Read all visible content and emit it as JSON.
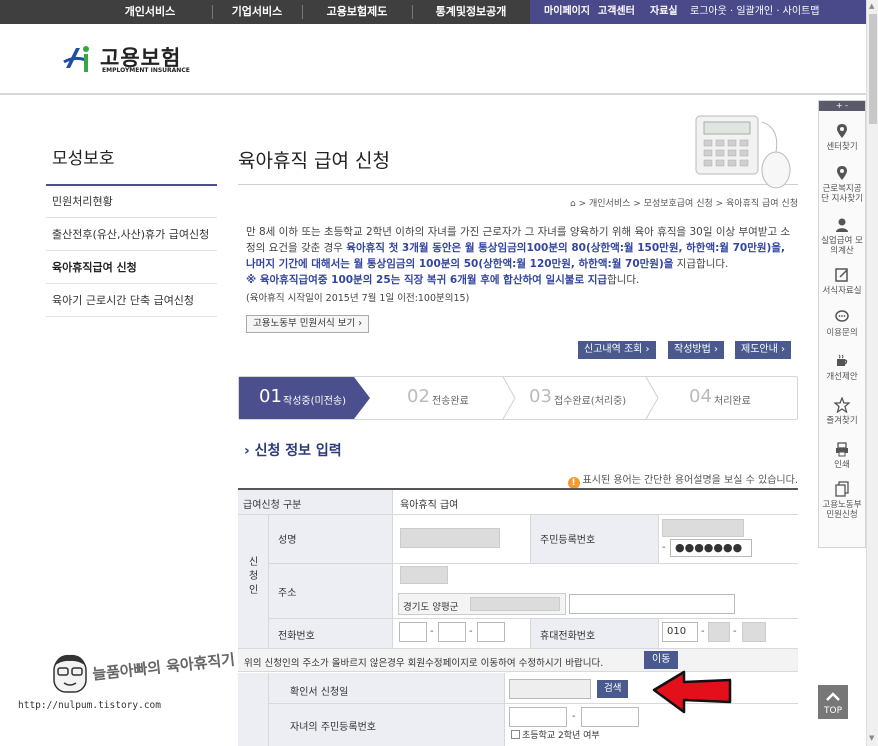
{
  "top_nav": {
    "items": [
      "개인서비스",
      "기업서비스",
      "고용보험제도",
      "통계및정보공개"
    ],
    "mypage": "마이페이지",
    "customer_center": "고객센터",
    "data_room": "자료실",
    "util": "로그아웃 · 일괄개인 · 사이트맵"
  },
  "logo": {
    "name": "고용보험",
    "sub": "EMPLOYMENT INSURANCE"
  },
  "left_menu": {
    "title": "모성보호",
    "items": [
      "민원처리현황",
      "출산전후(유산,사산)휴가 급여신청",
      "육아휴직급여 신청",
      "육아기 근로시간 단축 급여신청"
    ]
  },
  "page": {
    "title": "육아휴직 급여 신청",
    "breadcrumb": "> 개인서비스 > 모성보호급여 신청 > 육아휴직 급여 신청",
    "intro_1": "만 8세 이하 또는 초등학교 2학년 이하의 자녀를 가진 근로자가 그 자녀를 양육하기 위해 육아 휴직을 30일 이상 부여받고 소정의 요건을 갖춘 경우 ",
    "intro_hl_1": "육아휴직 첫 3개월 동안은 월 통상임금의100분의 80(상한액:월 150만원, 하한액:월 70만원)을, 나머지 기간에 대해서는 월 통상임금의 100분의 50(상한액:월 120만원, 하한액:월 70만원)을",
    "intro_2": " 지급합니다.",
    "intro_hl_2": "※ 육아휴직급여중 100분의 25는 직장 복귀 6개월 후에 합산하여 일시불로 지급",
    "intro_3": "합니다.",
    "intro_sub": "(육아휴직 시작일이 2015년 7월 1일 이전:100분의15)",
    "forms_btn": "고용노동부 민원서식 보기 ›",
    "btn_history": "신고내역 조회 ›",
    "btn_method": "작성방법 ›",
    "btn_guide": "제도안내 ›"
  },
  "steps": [
    {
      "num": "01",
      "label": "작성중(미전송)"
    },
    {
      "num": "02",
      "label": "전송완료"
    },
    {
      "num": "03",
      "label": "접수완료(처리중)"
    },
    {
      "num": "04",
      "label": "처리완료"
    }
  ],
  "form": {
    "section_title": "› 신청 정보 입력",
    "help_note": "표시된 용어는 간단한 용어설명을 보실 수 있습니다.",
    "help_dot": "!",
    "type_label": "급여신청 구분",
    "type_value": "육아휴직 급여",
    "applicant_label": "신\n청\n인",
    "name_label": "성명",
    "rrn_label": "주민등록번호",
    "rrn_masked": "●●●●●●●",
    "address_label": "주소",
    "address_value": "경기도 양평군",
    "phone_label": "전화번호",
    "mobile_label": "휴대전화번호",
    "mobile_prefix": "010",
    "dash": "-",
    "notice": "위의 신청인의 주소가 올바르지 않은경우 회원수정페이지로 이동하여 수정하시기 바랍니다.",
    "move_btn": "이동",
    "confirm_label": "확인서 신청일",
    "search_btn": "검색",
    "child_rrn_label": "자녀의 주민등록번호",
    "elementary_check": "초등학교 2학년 여부"
  },
  "quick_menu": {
    "head": "+ -",
    "items": [
      "센터찾기",
      "근로복지공단 지사찾기",
      "실업급여 모의계산",
      "서식자료실",
      "이용문의",
      "개선제안",
      "즐겨찾기",
      "인쇄",
      "고용노동부 민원신청"
    ],
    "top": "TOP"
  },
  "watermark": {
    "title": "늘품아빠의 육아휴직기",
    "url": "http://nulpum.tistory.com"
  }
}
